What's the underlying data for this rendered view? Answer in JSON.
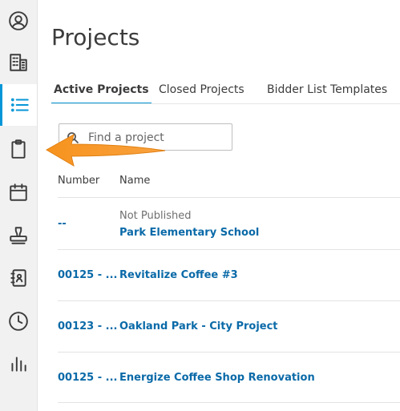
{
  "page": {
    "title": "Projects"
  },
  "sidebar": {
    "items": [
      {
        "icon": "user-circle-icon"
      },
      {
        "icon": "building-icon"
      },
      {
        "icon": "list-icon",
        "active": true
      },
      {
        "icon": "clipboard-icon"
      },
      {
        "icon": "calendar-icon"
      },
      {
        "icon": "stamp-icon"
      },
      {
        "icon": "address-book-icon"
      },
      {
        "icon": "clock-icon"
      },
      {
        "icon": "bar-chart-icon"
      }
    ],
    "accent": "#0696d7"
  },
  "tabs": [
    {
      "label": "Active Projects",
      "active": true
    },
    {
      "label": "Closed Projects"
    },
    {
      "label": "Bidder List Templates"
    }
  ],
  "search": {
    "placeholder": "Find a project",
    "value": ""
  },
  "table": {
    "headers": {
      "number": "Number",
      "name": "Name"
    },
    "rows": [
      {
        "number": "--",
        "status": "Not Published",
        "name": "Park Elementary School"
      },
      {
        "number": "00125 - ...",
        "name": "Revitalize Coffee #3"
      },
      {
        "number": "00123 - ...",
        "name": "Oakland Park - City Project"
      },
      {
        "number": "00125 - ...",
        "name": "Energize Coffee Shop Renovation"
      }
    ]
  },
  "colors": {
    "link": "#0a6aa8",
    "annotation_arrow": "#f7931e"
  }
}
